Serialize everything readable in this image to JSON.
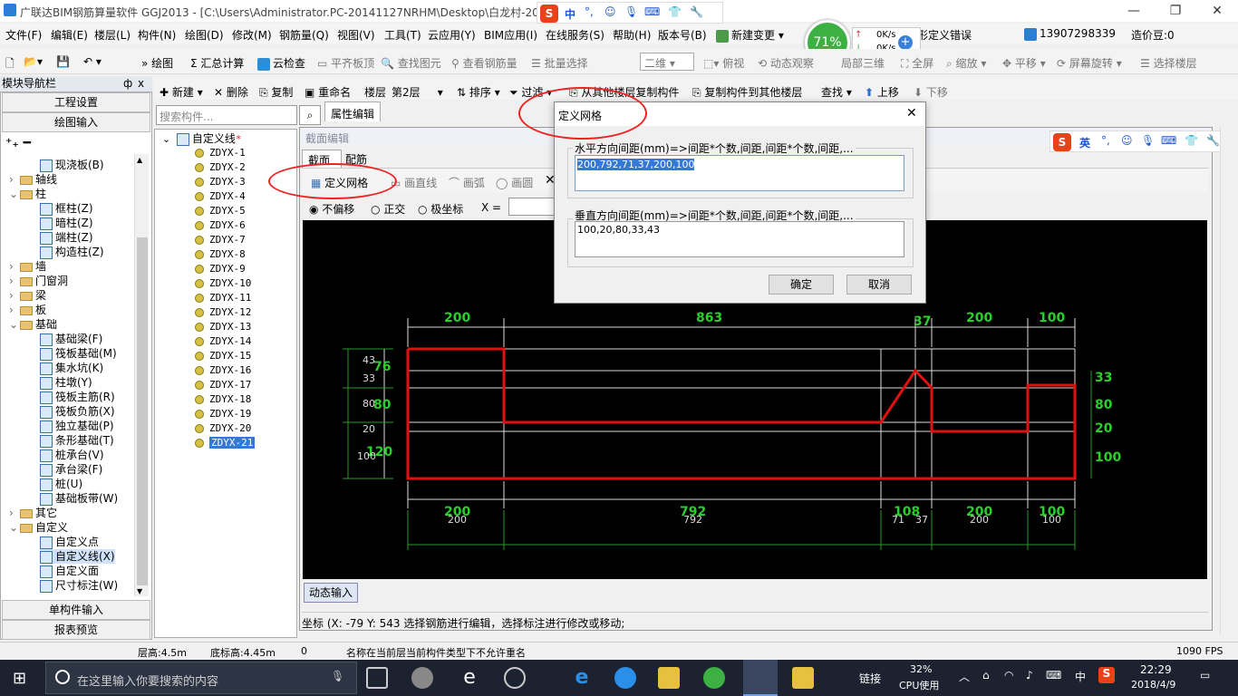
{
  "window": {
    "title": "广联达BIM钢筋算量软件 GGJ2013 - [C:\\Users\\Administrator.PC-20141127NRHM\\Desktop\\白龙村-20"
  },
  "menu": [
    "文件(F)",
    "编辑(E)",
    "楼层(L)",
    "构件(N)",
    "绘图(D)",
    "修改(M)",
    "钢筋量(Q)",
    "视图(V)",
    "工具(T)",
    "云应用(Y)",
    "BIM应用(I)",
    "在线服务(S)",
    "帮助(H)",
    "版本号(B)",
    "新建变更",
    "形定义错误",
    "13907298339",
    "造价豆:0"
  ],
  "toolbar1": {
    "draw": "绘图",
    "calc": "汇总计算",
    "cloud": "云检查",
    "flat": "平齐板顶",
    "find": "查找图元",
    "viewsteel": "查看钢筋量",
    "batch": "批量选择",
    "mode": "二维",
    "top": "俯视",
    "dyn": "动态观察",
    "partial": "局部三维",
    "full": "全屏",
    "zoom": "缩放",
    "pan": "平移",
    "rotate": "屏幕旋转",
    "sel": "选择楼层"
  },
  "perf": {
    "percent": "71%",
    "up": "0K/s",
    "down": "0K/s"
  },
  "toolbar2": {
    "new": "新建",
    "del": "删除",
    "copy": "复制",
    "rename": "重命名",
    "floor": "楼层",
    "floor_val": "第2层",
    "sort": "排序",
    "filter": "过滤",
    "from": "从其他楼层复制构件",
    "to": "复制构件到其他楼层",
    "find": "查找",
    "up": "上移",
    "down": "下移"
  },
  "nav": {
    "header": "模块导航栏",
    "pin": "ф",
    "close": "x",
    "btn_settings": "工程设置",
    "btn_draw": "绘图输入",
    "btn_single": "单构件输入",
    "btn_report": "报表预览"
  },
  "tree": [
    {
      "label": "现浇板(B)",
      "lvl": 2,
      "type": "i"
    },
    {
      "label": "轴线",
      "lvl": 1,
      "type": "f",
      "exp": "+"
    },
    {
      "label": "柱",
      "lvl": 1,
      "type": "f",
      "exp": "-"
    },
    {
      "label": "框柱(Z)",
      "lvl": 2,
      "type": "i"
    },
    {
      "label": "暗柱(Z)",
      "lvl": 2,
      "type": "i"
    },
    {
      "label": "端柱(Z)",
      "lvl": 2,
      "type": "i"
    },
    {
      "label": "构造柱(Z)",
      "lvl": 2,
      "type": "i"
    },
    {
      "label": "墙",
      "lvl": 1,
      "type": "f",
      "exp": "+"
    },
    {
      "label": "门窗洞",
      "lvl": 1,
      "type": "f",
      "exp": "+"
    },
    {
      "label": "梁",
      "lvl": 1,
      "type": "f",
      "exp": "+"
    },
    {
      "label": "板",
      "lvl": 1,
      "type": "f",
      "exp": "+"
    },
    {
      "label": "基础",
      "lvl": 1,
      "type": "f",
      "exp": "-"
    },
    {
      "label": "基础梁(F)",
      "lvl": 2,
      "type": "i"
    },
    {
      "label": "筏板基础(M)",
      "lvl": 2,
      "type": "i"
    },
    {
      "label": "集水坑(K)",
      "lvl": 2,
      "type": "i"
    },
    {
      "label": "柱墩(Y)",
      "lvl": 2,
      "type": "i"
    },
    {
      "label": "筏板主筋(R)",
      "lvl": 2,
      "type": "i"
    },
    {
      "label": "筏板负筋(X)",
      "lvl": 2,
      "type": "i"
    },
    {
      "label": "独立基础(P)",
      "lvl": 2,
      "type": "i"
    },
    {
      "label": "条形基础(T)",
      "lvl": 2,
      "type": "i"
    },
    {
      "label": "桩承台(V)",
      "lvl": 2,
      "type": "i"
    },
    {
      "label": "承台梁(F)",
      "lvl": 2,
      "type": "i"
    },
    {
      "label": "桩(U)",
      "lvl": 2,
      "type": "i"
    },
    {
      "label": "基础板带(W)",
      "lvl": 2,
      "type": "i"
    },
    {
      "label": "其它",
      "lvl": 1,
      "type": "f",
      "exp": "+"
    },
    {
      "label": "自定义",
      "lvl": 1,
      "type": "f",
      "exp": "-"
    },
    {
      "label": "自定义点",
      "lvl": 2,
      "type": "i"
    },
    {
      "label": "自定义线(X)",
      "lvl": 2,
      "type": "i",
      "sel": true
    },
    {
      "label": "自定义面",
      "lvl": 2,
      "type": "i"
    },
    {
      "label": "尺寸标注(W)",
      "lvl": 2,
      "type": "i"
    }
  ],
  "search": {
    "placeholder": "搜索构件..."
  },
  "components": {
    "root": "自定义线",
    "items": [
      "ZDYX-1",
      "ZDYX-2",
      "ZDYX-3",
      "ZDYX-4",
      "ZDYX-5",
      "ZDYX-6",
      "ZDYX-7",
      "ZDYX-8",
      "ZDYX-9",
      "ZDYX-10",
      "ZDYX-11",
      "ZDYX-12",
      "ZDYX-13",
      "ZDYX-14",
      "ZDYX-15",
      "ZDYX-16",
      "ZDYX-17",
      "ZDYX-18",
      "ZDYX-19",
      "ZDYX-20",
      "ZDYX-21"
    ],
    "selected": "ZDYX-21"
  },
  "propTab": "属性编辑",
  "editor": {
    "title": "截面编辑",
    "tab1": "截面",
    "tab2": "配筋",
    "grid": "定义网格",
    "line": "画直线",
    "arc": "画弧",
    "circle": "画圆",
    "opt1": "不偏移",
    "opt2": "正交",
    "opt3": "极坐标",
    "xlabel": "X =",
    "dyn": "动态输入",
    "coord": "坐标 (X: -79 Y: 543",
    "hint": "选择钢筋进行编辑，选择标注进行修改或移动;"
  },
  "drawing": {
    "top_dims": [
      "200",
      "863",
      "37",
      "200",
      "100"
    ],
    "bottom_dims": [
      "200",
      "792",
      "108",
      "200",
      "100"
    ],
    "bottom_sub": [
      "200",
      "792",
      "71",
      "37",
      "200",
      "100"
    ],
    "left_white": [
      "43",
      "33",
      "80",
      "20",
      "100"
    ],
    "left_green": [
      "76",
      "80",
      "120"
    ],
    "right_green": [
      "33",
      "80",
      "20",
      "100"
    ]
  },
  "dialog": {
    "title": "定义网格",
    "h_label": "水平方向间距(mm)=>间距*个数,间距,间距*个数,间距,...",
    "h_value": "200,792,71,37,200,100",
    "v_label": "垂直方向间距(mm)=>间距*个数,间距,间距*个数,间距,...",
    "v_value": "100,20,80,33,43",
    "ok": "确定",
    "cancel": "取消"
  },
  "ime": {
    "lang": "英",
    "lang2": "中"
  },
  "status": {
    "floor_h": "层高:4.5m",
    "base_h": "底标高:4.45m",
    "zero": "0",
    "msg": "名称在当前层当前构件类型下不允许重名",
    "fps": "1090 FPS"
  },
  "taskbar": {
    "search": "在这里输入你要搜索的内容",
    "link": "链接",
    "cpu": "32%",
    "cpu_label": "CPU使用",
    "ime": "中",
    "time": "22:29",
    "date": "2018/4/9"
  }
}
